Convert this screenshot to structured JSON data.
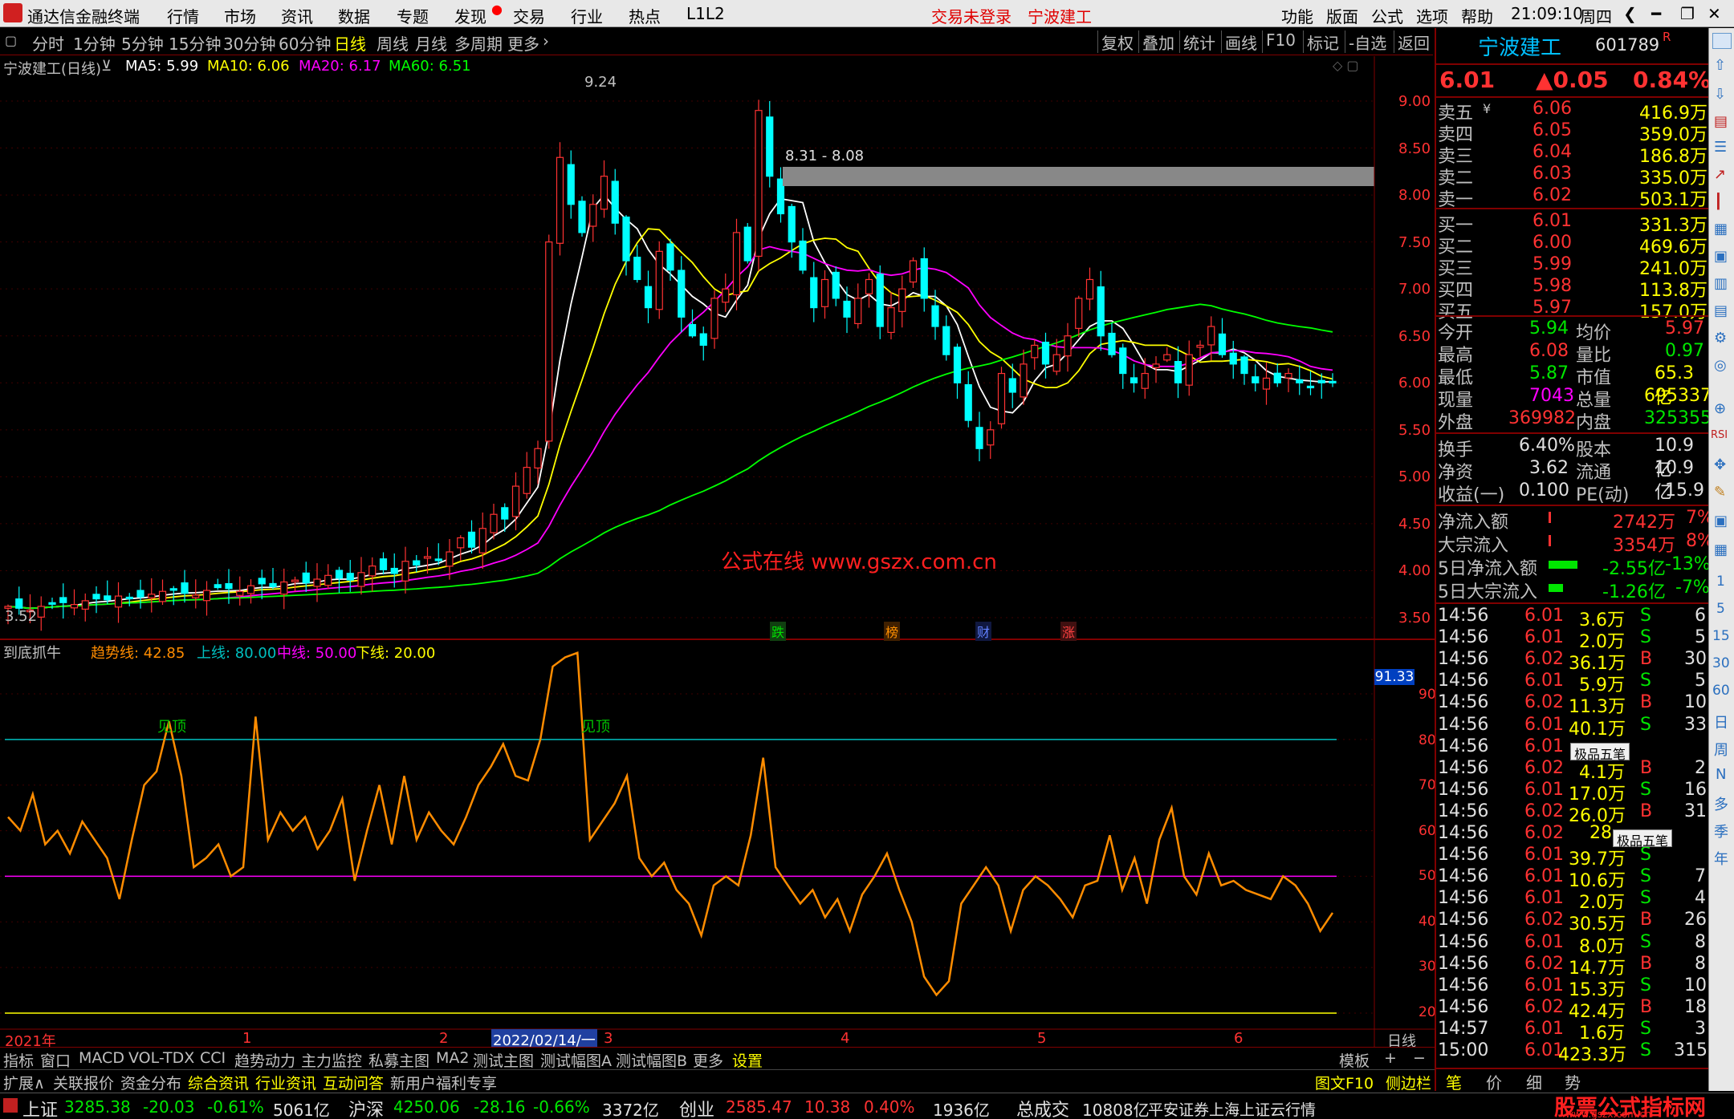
{
  "titlebar": {
    "app_name": "通达信金融终端",
    "menus": [
      "行情",
      "市场",
      "资讯",
      "数据",
      "专题",
      "发现",
      "交易",
      "行业",
      "热点",
      "L1L2"
    ],
    "login_status": "交易未登录",
    "stock_name": "宁波建工",
    "right_menus": [
      "功能",
      "版面",
      "公式",
      "选项",
      "帮助"
    ],
    "time": "21:09:10",
    "weekday": "周四"
  },
  "toolbar": {
    "periods": [
      "分时",
      "1分钟",
      "5分钟",
      "15分钟",
      "30分钟",
      "60分钟",
      "日线",
      "周线",
      "月线",
      "多周期",
      "更多"
    ],
    "active": "日线",
    "right_buttons": [
      "复权",
      "叠加",
      "统计",
      "画线",
      "F10",
      "标记",
      "-自选",
      "返回"
    ]
  },
  "main_chart": {
    "title": "宁波建工(日线)",
    "ma_labels": [
      {
        "text": "MA5: 5.99",
        "color": "#ffffff"
      },
      {
        "text": "MA10: 6.06",
        "color": "#ffff00"
      },
      {
        "text": "MA20: 6.17",
        "color": "#ff00ff"
      },
      {
        "text": "MA60: 6.51",
        "color": "#00ff00"
      }
    ],
    "high_label": "9.24",
    "low_label": "3.52",
    "range_label": "8.31 - 8.08",
    "watermark": "公式在线  www.gszx.com.cn",
    "events": [
      {
        "text": "跌",
        "color": "#00c000"
      },
      {
        "text": "榜",
        "color": "#ff8000"
      },
      {
        "text": "财",
        "color": "#4060ff"
      },
      {
        "text": "涨",
        "color": "#ff3030"
      }
    ]
  },
  "price_axis": [
    "9.00",
    "8.50",
    "8.00",
    "7.50",
    "7.00",
    "6.50",
    "6.00",
    "5.50",
    "5.00",
    "4.50",
    "4.00",
    "3.50"
  ],
  "indicator": {
    "title": "到底抓牛",
    "trend_label": "趋势线: 42.85",
    "upper_label": "上线: 80.00",
    "middle_label": "中线: 50.00",
    "lower_label": "下线: 20.00",
    "current_value": "91.33",
    "top_marker": "见顶",
    "axis": [
      "90.00",
      "80.00",
      "70.00",
      "60.00",
      "50.00",
      "40.00",
      "30.00",
      "20.00"
    ]
  },
  "time_axis": {
    "labels": [
      "2021年",
      "1",
      "2",
      "2022/02/14/一",
      "3",
      "4",
      "5",
      "6"
    ],
    "period_label": "日线"
  },
  "bottom_tabs": [
    "指标",
    "窗口",
    "MACD",
    "VOL-TDX",
    "CCI",
    "趋势动力",
    "主力监控",
    "私募主图",
    "MA2",
    "测试主图",
    "测试幅图A",
    "测试幅图B",
    "更多",
    "设置"
  ],
  "bottom_tabs2": [
    "扩展∧",
    "关联报价",
    "资金分布",
    "综合资讯",
    "行业资讯",
    "互动问答",
    "新用户福利专享"
  ],
  "template_label": "模板",
  "quote": {
    "name": "宁波建工",
    "code": "601789",
    "flag": "R",
    "price": "6.01",
    "change": "▲0.05",
    "pct": "0.84%",
    "asks": [
      {
        "label": "卖五",
        "price": "6.06",
        "vol": "416.9万"
      },
      {
        "label": "卖四",
        "price": "6.05",
        "vol": "359.0万"
      },
      {
        "label": "卖三",
        "price": "6.04",
        "vol": "186.8万"
      },
      {
        "label": "卖二",
        "price": "6.03",
        "vol": "335.0万"
      },
      {
        "label": "卖一",
        "price": "6.02",
        "vol": "503.1万"
      }
    ],
    "bids": [
      {
        "label": "买一",
        "price": "6.01",
        "vol": "331.3万"
      },
      {
        "label": "买二",
        "price": "6.00",
        "vol": "469.6万"
      },
      {
        "label": "买三",
        "price": "5.99",
        "vol": "241.0万"
      },
      {
        "label": "买四",
        "price": "5.98",
        "vol": "113.8万"
      },
      {
        "label": "买五",
        "price": "5.97",
        "vol": "157.0万"
      }
    ],
    "stats": [
      [
        "今开",
        "5.94",
        "均价",
        "5.97"
      ],
      [
        "最高",
        "6.08",
        "量比",
        "0.97"
      ],
      [
        "最低",
        "5.87",
        "市值",
        "65.3亿"
      ],
      [
        "现量",
        "7043",
        "总量",
        "695337"
      ],
      [
        "外盘",
        "369982",
        "内盘",
        "325355"
      ]
    ],
    "stats2": [
      [
        "换手",
        "6.40%",
        "股本",
        "10.9亿"
      ],
      [
        "净资",
        "3.62",
        "流通",
        "10.9亿"
      ],
      [
        "收益(一)",
        "0.100",
        "PE(动)",
        "15.9"
      ]
    ],
    "flows": [
      [
        "净流入额",
        "2742万",
        "7%"
      ],
      [
        "大宗流入",
        "3354万",
        "8%"
      ],
      [
        "5日净流入额",
        "-2.55亿",
        "-13%"
      ],
      [
        "5日大宗流入",
        "-1.26亿",
        "-7%"
      ]
    ],
    "ticks": [
      [
        "14:56",
        "6.01",
        "3.6万",
        "S",
        "6"
      ],
      [
        "14:56",
        "6.01",
        "2.0万",
        "S",
        "5"
      ],
      [
        "14:56",
        "6.02",
        "36.1万",
        "B",
        "30"
      ],
      [
        "14:56",
        "6.01",
        "5.9万",
        "S",
        "5"
      ],
      [
        "14:56",
        "6.02",
        "11.3万",
        "B",
        "10"
      ],
      [
        "14:56",
        "6.01",
        "40.1万",
        "S",
        "33"
      ],
      [
        "14:56",
        "6.01",
        "",
        "",
        ""
      ],
      [
        "14:56",
        "6.02",
        "4.1万",
        "B",
        "2"
      ],
      [
        "14:56",
        "6.01",
        "17.0万",
        "S",
        "16"
      ],
      [
        "14:56",
        "6.02",
        "26.0万",
        "B",
        "31"
      ],
      [
        "14:56",
        "6.02",
        "28.",
        "",
        ""
      ],
      [
        "14:56",
        "6.01",
        "39.7万",
        "S",
        ""
      ],
      [
        "14:56",
        "6.01",
        "10.6万",
        "S",
        "7"
      ],
      [
        "14:56",
        "6.01",
        "2.0万",
        "S",
        "4"
      ],
      [
        "14:56",
        "6.02",
        "30.5万",
        "B",
        "26"
      ],
      [
        "14:56",
        "6.01",
        "8.0万",
        "S",
        "8"
      ],
      [
        "14:56",
        "6.02",
        "14.7万",
        "B",
        "8"
      ],
      [
        "14:56",
        "6.01",
        "15.3万",
        "S",
        "10"
      ],
      [
        "14:56",
        "6.02",
        "42.4万",
        "B",
        "18"
      ],
      [
        "14:57",
        "6.01",
        "1.6万",
        "S",
        "3"
      ],
      [
        "15:00",
        "6.01",
        "423.3万",
        "S",
        "315"
      ]
    ],
    "ime_label": "极品五笔"
  },
  "bottom_right": {
    "f10": "图文F10",
    "sidebar": "侧边栏",
    "tabs": [
      "笔",
      "价",
      "细",
      "势"
    ]
  },
  "statusbar": {
    "items": [
      {
        "name": "上证",
        "value": "3285.38",
        "chg": "-20.03",
        "pct": "-0.61%",
        "amt": "5061亿"
      },
      {
        "name": "沪深",
        "value": "4250.06",
        "chg": "-28.16",
        "pct": "-0.66%",
        "amt": "3372亿"
      },
      {
        "name": "创业",
        "value": "2585.47",
        "chg": "10.38",
        "pct": "0.40%",
        "amt": "1936亿"
      }
    ],
    "total_label": "总成交",
    "total": "10808亿",
    "source": "平安证券上海上证云行情",
    "logo": "股票公式指标网",
    "logo_url": "www.gszx.com.cn"
  },
  "side_tools": [
    "日",
    "周",
    "N",
    "多",
    "季",
    "年"
  ],
  "side_numbers": [
    "1",
    "5",
    "15",
    "30",
    "60"
  ],
  "chart_data": {
    "type": "candlestick",
    "closes": [
      3.62,
      3.6,
      3.58,
      3.62,
      3.65,
      3.66,
      3.64,
      3.68,
      3.7,
      3.69,
      3.73,
      3.71,
      3.72,
      3.75,
      3.78,
      3.8,
      3.76,
      3.74,
      3.79,
      3.82,
      3.81,
      3.78,
      3.84,
      3.86,
      3.83,
      3.88,
      3.9,
      3.87,
      3.91,
      3.95,
      3.92,
      3.9,
      3.98,
      4.05,
      4.01,
      3.97,
      4.1,
      4.06,
      4.15,
      4.12,
      4.2,
      4.35,
      4.25,
      4.45,
      4.6,
      4.55,
      4.9,
      5.1,
      5.3,
      7.5,
      8.4,
      7.9,
      7.6,
      7.9,
      8.2,
      7.7,
      7.3,
      7.1,
      6.8,
      7.4,
      7.2,
      6.7,
      6.5,
      6.4,
      6.9,
      7.0,
      7.6,
      7.3,
      8.9,
      8.2,
      7.8,
      7.5,
      7.2,
      6.8,
      7.1,
      6.9,
      6.7,
      6.9,
      7.1,
      6.6,
      6.8,
      7.0,
      7.3,
      6.9,
      6.6,
      6.3,
      6.0,
      5.6,
      5.3,
      5.5,
      6.1,
      5.9,
      6.2,
      6.4,
      6.2,
      6.3,
      6.5,
      6.9,
      7.1,
      6.5,
      6.3,
      6.1,
      6.0,
      6.1,
      6.2,
      6.3,
      6.0,
      6.3,
      6.4,
      6.6,
      6.3,
      6.2,
      6.1,
      6.0,
      6.05,
      6.0,
      6.1,
      6.0,
      5.95,
      6.0,
      6.01
    ]
  }
}
